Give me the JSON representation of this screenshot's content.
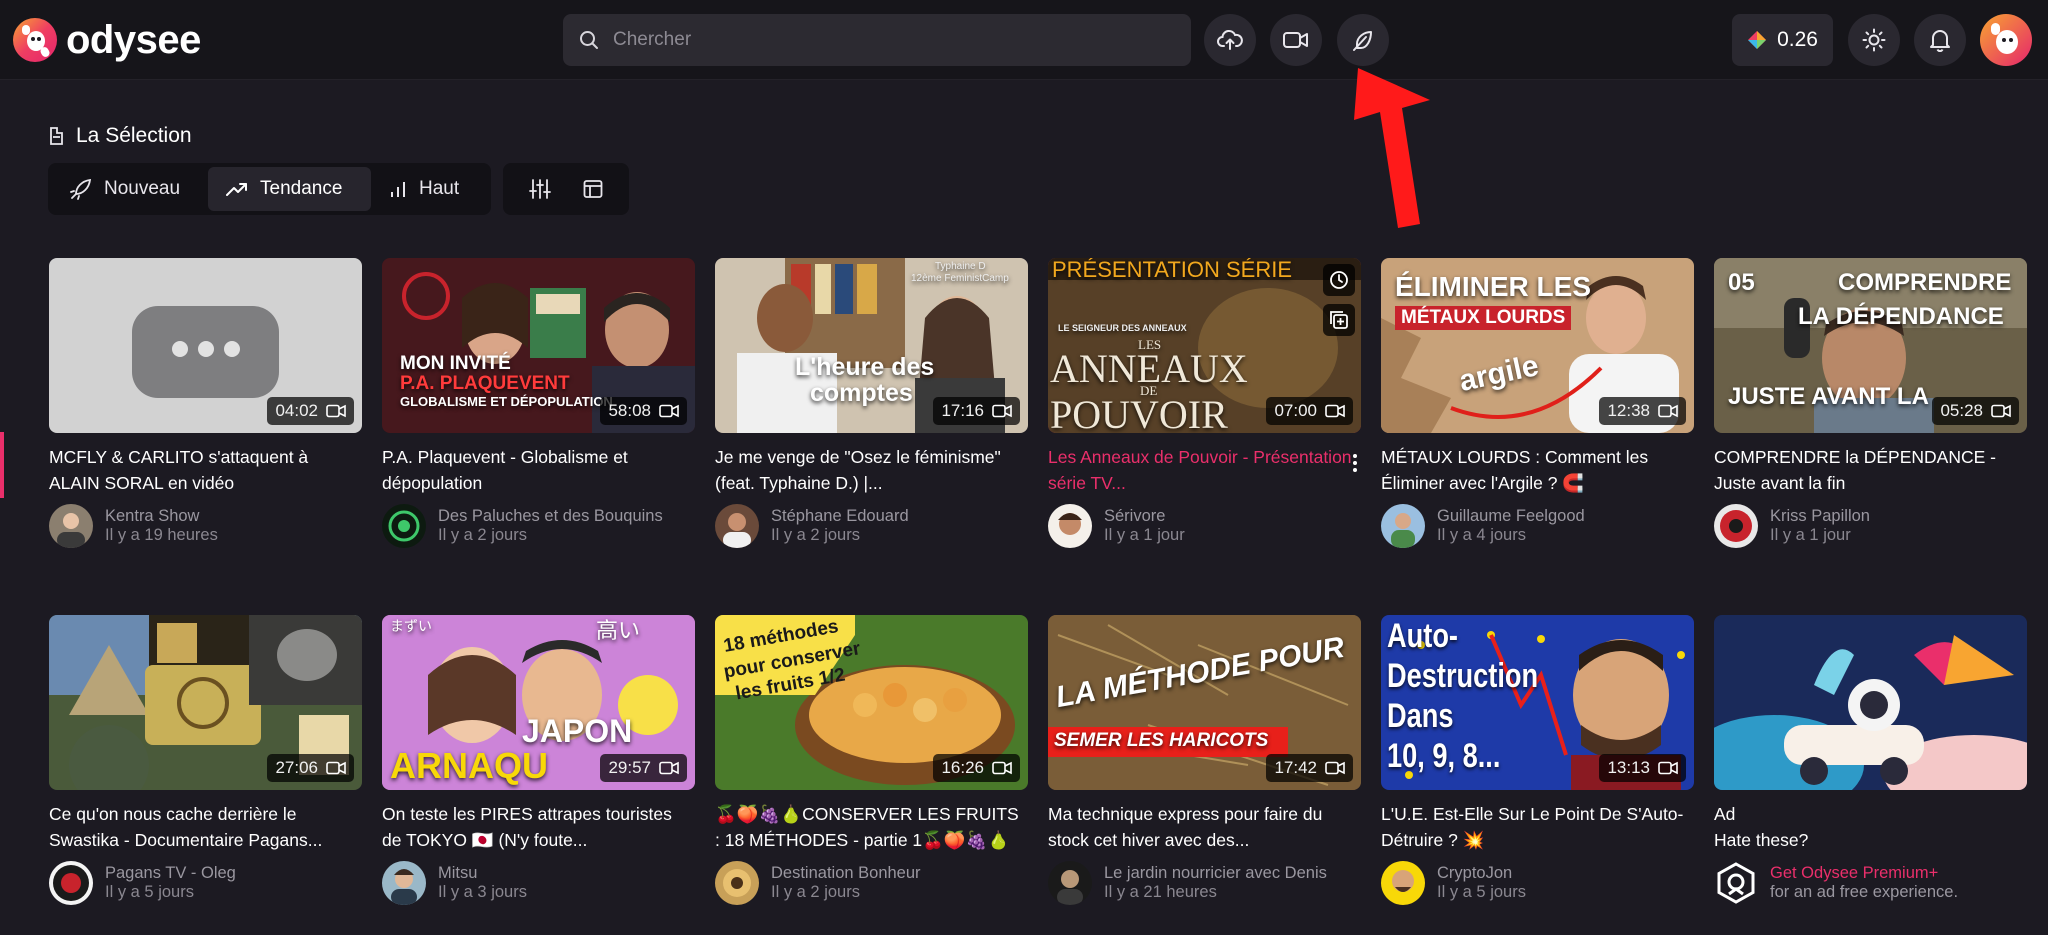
{
  "header": {
    "brand": "odysee",
    "search_placeholder": "Chercher",
    "credits": "0.26"
  },
  "section": {
    "title": "La Sélection",
    "tabs": [
      {
        "label": "Nouveau",
        "icon": "rocket-icon",
        "active": false
      },
      {
        "label": "Tendance",
        "icon": "trending-icon",
        "active": true
      },
      {
        "label": "Haut",
        "icon": "bar-chart-icon",
        "active": false
      }
    ]
  },
  "videos": [
    {
      "title": "MCFLY & CARLITO s'attaquent à ALAIN SORAL en vidéo",
      "duration": "04:02",
      "channel": "Kentra Show",
      "time": "Il y a 19 heures"
    },
    {
      "title": "P.A. Plaquevent - Globalisme et dépopulation",
      "duration": "58:08",
      "channel": "Des Paluches et des Bouquins",
      "time": "Il y a 2 jours",
      "thumb_text": [
        "MON INVITÉ",
        "P.A. PLAQUEVENT",
        "GLOBALISME ET DÉPOPULATION"
      ]
    },
    {
      "title": "Je me venge de \"Osez le féminisme\" (feat. Typhaine D.) |...",
      "duration": "17:16",
      "channel": "Stéphane Edouard",
      "time": "Il y a 2 jours",
      "thumb_text": [
        "L'heure des",
        "comptes",
        "Typhaine D",
        "12ème FeministCamp"
      ]
    },
    {
      "title": "Les Anneaux de Pouvoir - Présentation série TV...",
      "duration": "07:00",
      "channel": "Sérivore",
      "time": "Il y a 1 jour",
      "thumb_text": [
        "PRÉSENTATION SÉRIE",
        "LE SEIGNEUR DES ANNEAUX",
        "LES",
        "ANNEAUX",
        "DE",
        "POUVOIR"
      ]
    },
    {
      "title": "MÉTAUX LOURDS : Comment les Éliminer avec l'Argile ? 🧲",
      "duration": "12:38",
      "channel": "Guillaume Feelgood",
      "time": "Il y a 4 jours",
      "thumb_text": [
        "ÉLIMINER LES",
        "MÉTAUX LOURDS",
        "argile"
      ]
    },
    {
      "title": "COMPRENDRE la DÉPENDANCE - Juste avant la fin",
      "duration": "05:28",
      "channel": "Kriss Papillon",
      "time": "Il y a 1 jour",
      "thumb_text": [
        "05",
        "COMPRENDRE",
        "LA DÉPENDANCE",
        "JUSTE AVANT LA"
      ]
    },
    {
      "title": "Ce qu'on nous cache derrière le Swastika - Documentaire Pagans...",
      "duration": "27:06",
      "channel": "Pagans TV - Oleg",
      "time": "Il y a 5 jours"
    },
    {
      "title": "On teste les PIRES attrapes touristes de TOKYO 🇯🇵 (N'y foute...",
      "duration": "29:57",
      "channel": "Mitsu",
      "time": "Il y a 3 jours",
      "thumb_text": [
        "まずい",
        "高い",
        "JAPON",
        "ARNAQU"
      ]
    },
    {
      "title": "🍒🍑🍇🍐CONSERVER LES FRUITS : 18 MÉTHODES - partie 1🍒🍑🍇🍐",
      "duration": "16:26",
      "channel": "Destination Bonheur",
      "time": "Il y a 2 jours",
      "thumb_text": [
        "18 méthodes",
        "pour conserver",
        "les fruits 1/2"
      ]
    },
    {
      "title": "Ma technique express pour faire du stock cet hiver avec des...",
      "duration": "17:42",
      "channel": "Le jardin nourricier avec Denis",
      "time": "Il y a 21 heures",
      "thumb_text": [
        "LA MÉTHODE POUR",
        "SEMER LES HARICOTS"
      ]
    },
    {
      "title": "L'U.E. Est-Elle Sur Le Point De S'Auto-Détruire ? 💥",
      "duration": "13:13",
      "channel": "CryptoJon",
      "time": "Il y a 5 jours",
      "thumb_text": [
        "Auto-",
        "Destruction",
        "Dans",
        "10, 9, 8..."
      ]
    }
  ],
  "ad": {
    "title": "Ad",
    "subtitle": "Hate these?",
    "link": "Get Odysee Premium+",
    "desc": "for an ad free experience."
  },
  "colors": {
    "accent": "#ea2f6b",
    "background": "#1c1a22",
    "header": "#16151a"
  }
}
